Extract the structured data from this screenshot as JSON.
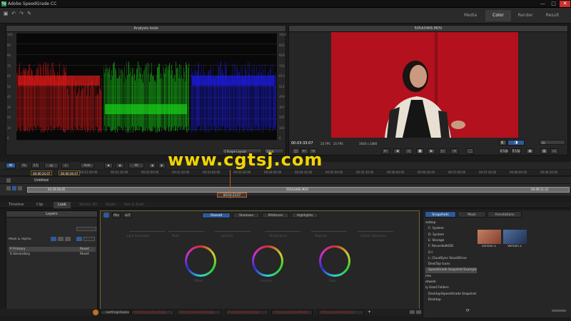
{
  "window": {
    "title": "Adobe SpeedGrade CC",
    "icon_letter": "Sg",
    "minimize": "—",
    "maximize": "□",
    "close": "✕"
  },
  "toolbar": {
    "icons": [
      "save-icon",
      "undo-icon",
      "redo-icon",
      "settings-icon"
    ],
    "tabs": [
      {
        "label": "Media"
      },
      {
        "label": "Color"
      },
      {
        "label": "Render"
      },
      {
        "label": "Result"
      }
    ]
  },
  "scopes": {
    "header": "Analysis tools",
    "axis_left": [
      "100",
      "90",
      "80",
      "70",
      "60",
      "50",
      "40",
      "30",
      "20",
      "10",
      "0"
    ],
    "axis_right": [
      "1023",
      "920",
      "818",
      "716",
      "613",
      "511",
      "409",
      "307",
      "205",
      "102",
      "0"
    ],
    "layout_select": "1 Scope Layout",
    "bit_select": "10bit",
    "colors": {
      "red": "#e01818",
      "green": "#18d018",
      "blue": "#1c1ce0"
    }
  },
  "viewer": {
    "header": "505A3466.MOV",
    "timecode": "00:03:33:07",
    "fps1": "25 FPS",
    "fps2": "25 FPS",
    "resolution": "1920 x 1080",
    "fit_select": "Fit",
    "view_2up": "2-Up",
    "view_3up": "3-Up"
  },
  "timeline": {
    "all_button": "All",
    "auto_button": "Auto",
    "all2_button": "All",
    "in_tc": "00:00:24:07",
    "out_tc": "00:00:26:07",
    "ticks": [
      "00:01:00:00",
      "00:01:30:00",
      "00:02:00:00",
      "00:02:30:00",
      "00:03:00:00",
      "00:03:30:00",
      "00:04:00:00",
      "00:04:30:00",
      "00:05:00:00",
      "00:05:30:00",
      "00:06:00:00",
      "00:06:30:00",
      "00:07:00:00",
      "00:07:30:00",
      "00:08:00:00",
      "00:08:30:00"
    ],
    "sequence_name": "Untitled",
    "clip_start": "03:59:26:05",
    "clip_name": "505A3466.MOV",
    "clip_end": "04:09:11:22",
    "current_tc": "00:03:33:07"
  },
  "bottom_tabs": [
    {
      "label": "Timeline"
    },
    {
      "label": "Clip"
    },
    {
      "label": "Look"
    },
    {
      "label": "Stereo 3D"
    },
    {
      "label": "Audio"
    },
    {
      "label": "Pan & Scan"
    }
  ],
  "layers": {
    "header": "Layers",
    "mask_alpha": "Mask & Alpha:",
    "rows": [
      {
        "name": "P  Primary",
        "reset": "Reset"
      },
      {
        "name": "S  Secondary",
        "reset": "Reset"
      }
    ],
    "bottom_buttons": [
      "+P",
      "+S",
      "+",
      "copy",
      "link",
      "trash"
    ]
  },
  "grade": {
    "top_toggle_1": "Mix",
    "top_toggle_2": "LUT",
    "tabs": [
      {
        "label": "Overall"
      },
      {
        "label": "Shadows"
      },
      {
        "label": "Midtones"
      },
      {
        "label": "Highlights"
      }
    ],
    "dim_labels": [
      "Input Saturation",
      "Pivot",
      "Contrast",
      "Temperature",
      "Magenta",
      "Output Saturation"
    ],
    "wheel_labels": [
      "Offset",
      "Gamma",
      "Gain"
    ]
  },
  "statusbar": {
    "tabs": [
      {
        "label": "...\\settings\\looks",
        "red": false
      },
      {
        "label": "Film Emulation/Agfa",
        "red": true
      },
      {
        "label": "Film Emulation/Kodak",
        "red": true
      },
      {
        "label": "Film Emulation/Fuji",
        "red": true
      },
      {
        "label": "Film Emulation/B&W",
        "red": true
      },
      {
        "label": "Film Emulation/Color",
        "red": true
      }
    ],
    "add": "+"
  },
  "right_panel": {
    "tabs": [
      {
        "label": "Snapshots"
      },
      {
        "label": "Mask"
      },
      {
        "label": "Annotations"
      }
    ],
    "folders": [
      "esktop",
      "C: System",
      "D: System",
      "E: Storage",
      "F: RecordedHDD",
      "G:\\",
      "L: CloudSync SmartDrive",
      "DeskTop Icons",
      "SpeedGrade Snapshot Example",
      "ime",
      "etwork",
      "ly Used Folders",
      "Desktop\\SpeedGrade Snapshot",
      "Desktop"
    ],
    "thumbs": [
      {
        "label": "version 1"
      },
      {
        "label": "Version 2"
      }
    ]
  },
  "watermark": "www.cgtsj.com"
}
